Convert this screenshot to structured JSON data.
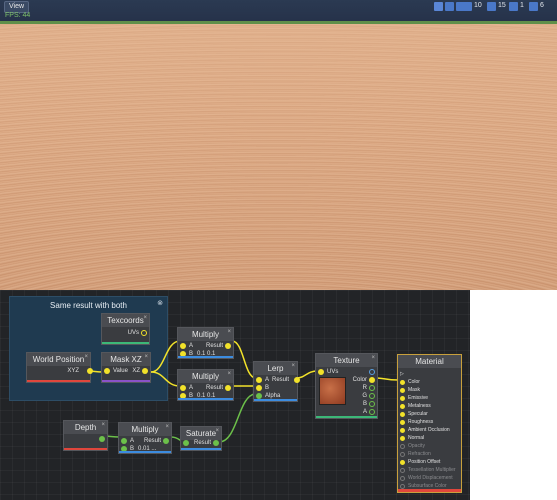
{
  "viewport": {
    "view_button": "View",
    "fps": "FPS: 44",
    "toolbar": {
      "count_a": "10",
      "count_b": "15",
      "count_c": "1",
      "count_d": "6"
    }
  },
  "graph": {
    "group_title": "Same result with both",
    "nodes": {
      "texcoords": {
        "title": "Texcoords",
        "out": "UVs"
      },
      "world_position": {
        "title": "World Position",
        "out": "XYZ"
      },
      "mask_xz": {
        "title": "Mask XZ",
        "in": "Value",
        "out": "XZ"
      },
      "multiply1": {
        "title": "Multiply",
        "a": "A",
        "b": "B",
        "bval": "0.1  0.1",
        "out": "Result"
      },
      "multiply2": {
        "title": "Multiply",
        "a": "A",
        "b": "B",
        "bval": "0.1  0.1",
        "out": "Result"
      },
      "lerp": {
        "title": "Lerp",
        "a": "A",
        "b": "B",
        "alpha": "Alpha",
        "out": "Result"
      },
      "texture": {
        "title": "Texture",
        "in": "UVs",
        "color": "Color",
        "r": "R",
        "g": "G",
        "b": "B",
        "a": "A"
      },
      "depth": {
        "title": "Depth"
      },
      "multiply3": {
        "title": "Multiply",
        "a": "A",
        "b": "B",
        "bval": "0.01 ...",
        "out": "Result"
      },
      "saturate": {
        "title": "Saturate",
        "out": "Result"
      }
    },
    "material": {
      "title": "Material",
      "inputs": [
        {
          "label": "Color",
          "state": "active"
        },
        {
          "label": "Mask",
          "state": "active"
        },
        {
          "label": "Emissive",
          "state": "active"
        },
        {
          "label": "Metalness",
          "state": "active"
        },
        {
          "label": "Specular",
          "state": "active"
        },
        {
          "label": "Roughness",
          "state": "active"
        },
        {
          "label": "Ambient Occlusion",
          "state": "active"
        },
        {
          "label": "Normal",
          "state": "active"
        },
        {
          "label": "Opacity",
          "state": "disabled"
        },
        {
          "label": "Refraction",
          "state": "disabled"
        },
        {
          "label": "Position Offset",
          "state": "active"
        },
        {
          "label": "Tessellation Multiplier",
          "state": "disabled"
        },
        {
          "label": "World Displacement",
          "state": "disabled"
        },
        {
          "label": "Subsurface Color",
          "state": "disabled"
        }
      ]
    },
    "colors": {
      "pin_yellow": "#f2e22a",
      "pin_green": "#6cc04a",
      "accent_orange": "#c8a03c"
    }
  }
}
